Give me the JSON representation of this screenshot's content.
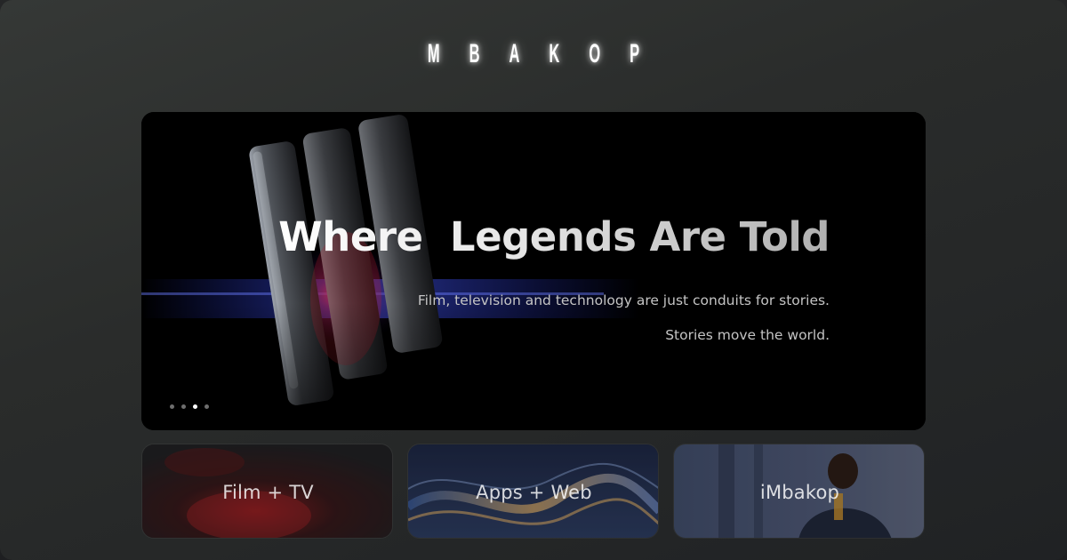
{
  "brand": {
    "name": "MBAKOP"
  },
  "hero": {
    "title": "Where  Legends Are Told",
    "subtitle_line1": "Film, television and technology are just conduits for stories.",
    "subtitle_line2": "Stories move the world.",
    "carousel": {
      "slide_count": 4,
      "active_index": 2
    }
  },
  "cards": [
    {
      "label": "Film + TV"
    },
    {
      "label": "Apps + Web"
    },
    {
      "label": "iMbakop"
    }
  ],
  "colors": {
    "background": "#2b2d2c",
    "hero_background": "#000000",
    "text": "#ffffff",
    "subtitle": "#c4c4c4",
    "accent_red": "#b2262a",
    "accent_gold": "#d9a860",
    "accent_blue": "#3a5d9c"
  }
}
